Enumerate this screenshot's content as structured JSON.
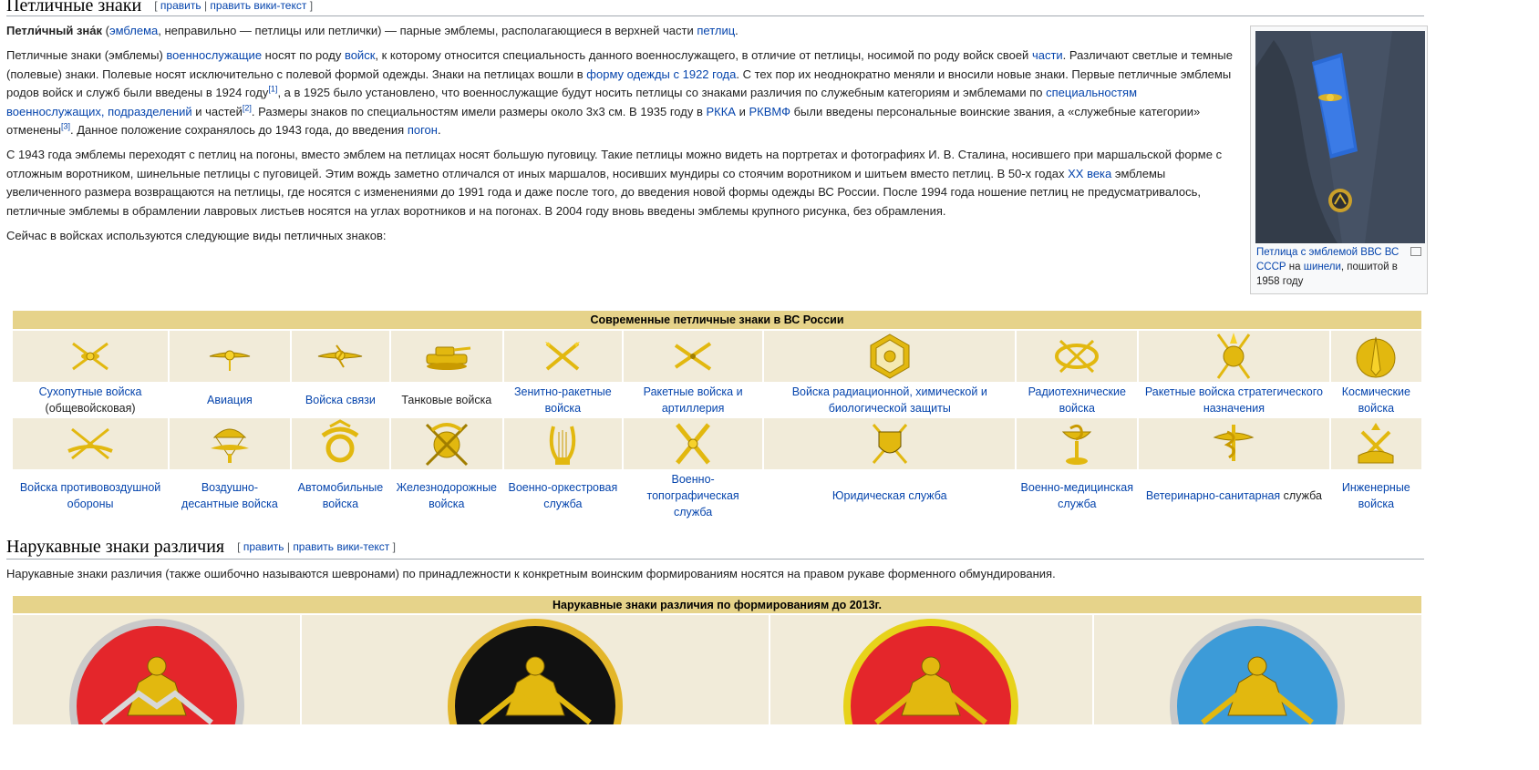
{
  "section1": {
    "title": "Петличные знаки",
    "edit": {
      "open": "[",
      "edit_link": "править",
      "sep": "|",
      "edit_source_link": "править вики-текст",
      "close": "]"
    }
  },
  "intro": {
    "term": "Петли́чный зна́к",
    "p1": " (",
    "l1": "эмблема",
    "p2": ", неправильно — петлицы или петлички) — парные эмблемы, располагающиеся в верхней части ",
    "l2": "петлиц",
    "p3": "."
  },
  "para2": {
    "t1": "Петличные знаки (эмблемы) ",
    "l1": "военнослужащие",
    "t2": " носят по роду ",
    "l2": "войск",
    "t3": ", к которому относится специальность данного военнослужащего, в отличие от петлицы, носимой по роду войск своей ",
    "l3": "части",
    "t4": ". Различают светлые и темные (полевые) знаки. Полевые носят исключительно с полевой формой одежды. Знаки на петлицах вошли в ",
    "l4": "форму одежды с 1922 года",
    "t5": ". С тех пор их неоднократно меняли и вносили новые знаки. Первые петличные эмблемы родов войск и служб были введены в 1924 году",
    "s1": "[1]",
    "t6": ", а в 1925 было установлено, что военнослужащие будут носить петлицы со знаками различия по служебным категориям и эмблемами по ",
    "l5": "специальностям военнослужащих, подразделений",
    "t7": " и частей",
    "s2": "[2]",
    "t8": ". Размеры знаков по специальностям имели размеры около 3х3 см. В 1935 году в ",
    "l6": "РККА",
    "t9": " и ",
    "l7": "РКВМФ",
    "t10": " были введены персональные воинские звания, а «служебные категории» отменены",
    "s3": "[3]",
    "t11": ". Данное положение сохранялось до 1943 года, до введения ",
    "l8": "погон",
    "t12": "."
  },
  "para3": {
    "t1": "С 1943 года эмблемы переходят с петлиц на погоны, вместо эмблем на петлицах носят большую пуговицу. Такие петлицы можно видеть на портретах и фотографиях И. В. Сталина, носившего при маршальской форме с отложным воротником, шинельные петлицы с пуговицей. Этим вождь заметно отличался от иных маршалов, носивших мундиры со стоячим воротником и шитьем вместо петлиц. В 50-х годах ",
    "l1": "XX века",
    "t2": " эмблемы увеличенного размера возвращаются на петлицы, где носятся с изменениями до 1991 года и даже после того, до введения новой формы одежды ВС России. После 1994 года ношение петлиц не предусматривалось, петличные эмблемы в обрамлении лавровых листьев носятся на углах воротников и на погонах. В 2004 году вновь введены эмблемы крупного рисунка, без обрамления."
  },
  "para4": "Сейчас в войсках используются следующие виды петличных знаков:",
  "thumb": {
    "cap_l1": "Петлица с эмблемой ВВС ВС СССР",
    "cap_t1": " на ",
    "cap_l2": "шинели",
    "cap_t2": ", пошитой в 1958 году"
  },
  "emblem_table": {
    "title": "Современные петличные знаки в ВС России",
    "row1": [
      {
        "l": "Сухопутные войска",
        "t": " (общевойсковая)",
        "icon": "ground-forces-emblem"
      },
      {
        "l": "Авиация",
        "t": "",
        "icon": "aviation-emblem"
      },
      {
        "l": "Войска связи",
        "t": "",
        "icon": "signal-troops-emblem"
      },
      {
        "l": "",
        "t": "Танковые войска",
        "icon": "tank-emblem"
      },
      {
        "l": "Зенитно-ракетные войска",
        "t": "",
        "icon": "air-defense-missile-emblem"
      },
      {
        "l": "Ракетные войска и артиллерия",
        "t": "",
        "icon": "artillery-emblem"
      },
      {
        "l": "Войска радиационной, химической и биологической защиты",
        "t": "",
        "icon": "rchbz-emblem"
      },
      {
        "l": "Радиотехнические войска",
        "t": "",
        "icon": "radio-tech-emblem"
      },
      {
        "l": "Ракетные войска стратегического назначения",
        "t": "",
        "icon": "strategic-missile-emblem"
      },
      {
        "l": "Космические войска",
        "t": "",
        "icon": "space-forces-emblem"
      }
    ],
    "row2": [
      {
        "l": "Войска противовоздушной обороны",
        "t": "",
        "icon": "air-defense-emblem"
      },
      {
        "l": "Воздушно-десантные войска",
        "t": "",
        "icon": "airborne-emblem"
      },
      {
        "l": "Автомобильные войска",
        "t": "",
        "icon": "automobile-emblem"
      },
      {
        "l": "Железнодорожные войска",
        "t": "",
        "icon": "railway-emblem"
      },
      {
        "l": "Военно-оркестровая служба",
        "t": "",
        "icon": "lyre-emblem"
      },
      {
        "l": "Военно-топографическая служба",
        "t": "",
        "icon": "topography-emblem"
      },
      {
        "l": "Юридическая служба",
        "t": "",
        "icon": "legal-service-emblem"
      },
      {
        "l": "Военно-медицинская служба",
        "t": "",
        "icon": "medical-emblem"
      },
      {
        "l": "Ветеринарно-санитарная",
        "t": " служба",
        "icon": "veterinary-emblem"
      },
      {
        "l": "Инженерные войска",
        "t": "",
        "icon": "engineer-emblem"
      }
    ]
  },
  "section2": {
    "title": "Нарукавные знаки различия",
    "edit": {
      "open": "[",
      "edit_link": "править",
      "sep": "|",
      "edit_source_link": "править вики-текст",
      "close": "]"
    },
    "text": "Нарукавные знаки различия (также ошибочно называются шевронами) по принадлежности к конкретным воинским формированиям носятся на правом рукаве форменного обмундирования."
  },
  "sleeve_table": {
    "title": "Нарукавные знаки различия по формированиям до 2013г.",
    "patches": [
      {
        "ring": "#c9c9c9",
        "fill": "#e4262b"
      },
      {
        "ring": "#e3b62a",
        "fill": "#111111"
      },
      {
        "ring": "#e7d21a",
        "fill": "#e4262b"
      },
      {
        "ring": "#c9c9c9",
        "fill": "#3c9bd8"
      }
    ]
  },
  "colors": {
    "link": "#0645ad",
    "header_bg": "#e6d38a",
    "cell_bg": "#f1ebd9",
    "gold": "#e2b80f"
  }
}
